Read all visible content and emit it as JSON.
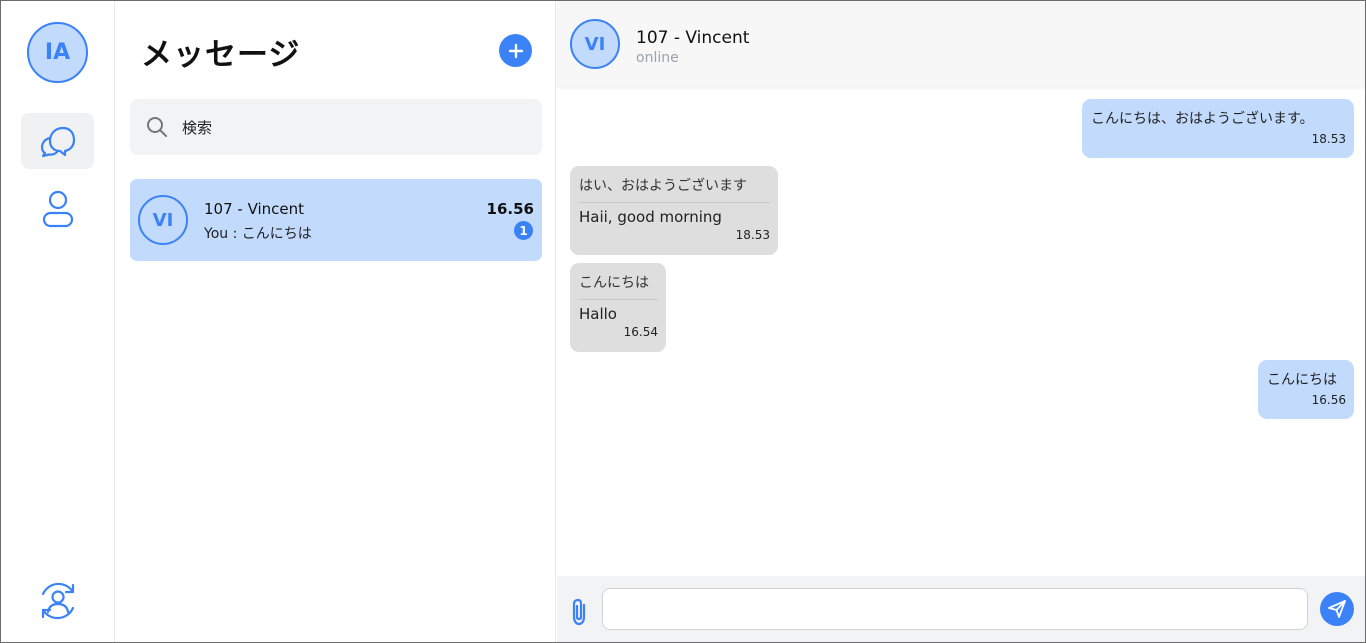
{
  "user": {
    "initials": "IA"
  },
  "sidebar": {
    "items": [
      {
        "icon": "chat-bubbles-icon",
        "active": true
      },
      {
        "icon": "user-icon",
        "active": false
      }
    ],
    "footer_icon": "user-switch-icon"
  },
  "conversations": {
    "title": "メッセージ",
    "new_icon": "plus-icon",
    "search_placeholder": "検索",
    "items": [
      {
        "initials": "VI",
        "name": "107 - Vincent",
        "preview": "You : こんにちは",
        "time": "16.56",
        "unread": "1"
      }
    ]
  },
  "chat": {
    "contact": {
      "initials": "VI",
      "name": "107 - Vincent",
      "status": "online"
    },
    "messages": [
      {
        "direction": "out",
        "text": "こんにちは、おはようございます。",
        "time": "18.53"
      },
      {
        "direction": "in",
        "original": "はい、おはようございます",
        "translation": "Haii, good morning",
        "time": "18.53"
      },
      {
        "direction": "in",
        "original": "こんにちは",
        "translation": "Hallo",
        "time": "16.54"
      },
      {
        "direction": "out",
        "text": "こんにちは",
        "time": "16.56"
      }
    ],
    "composer": {
      "value": "",
      "attach_icon": "paperclip-icon",
      "send_icon": "send-icon"
    }
  },
  "colors": {
    "accent": "#3b82f6",
    "bubble_out": "#c2dbfd",
    "bubble_in": "#dedede",
    "status": "#9aa3ad"
  }
}
